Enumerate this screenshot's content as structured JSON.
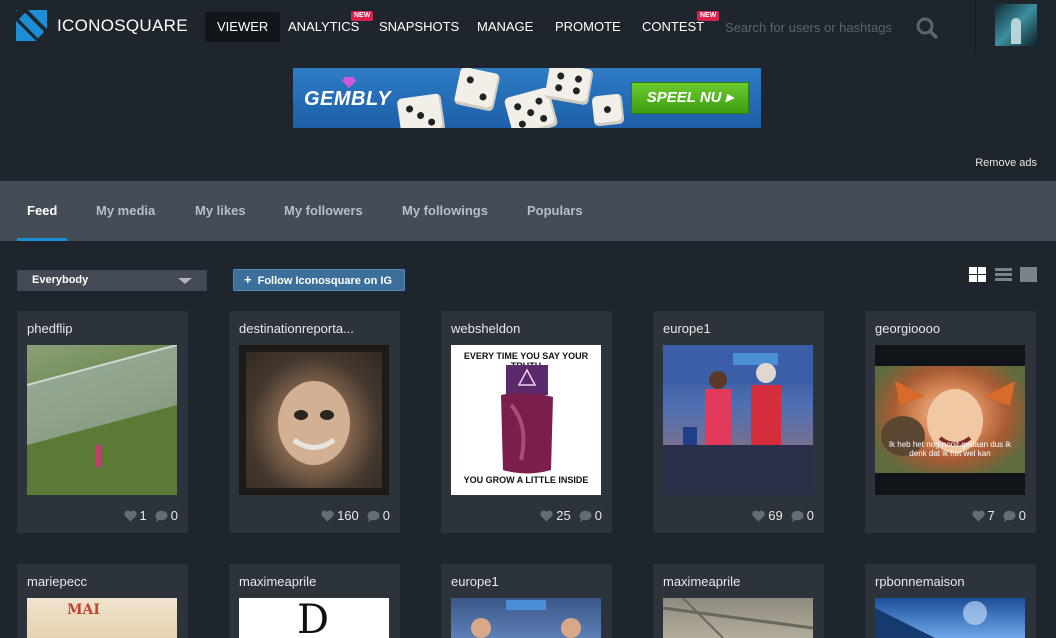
{
  "brand": {
    "name_light": "ICONO",
    "name_bold": "SQUARE",
    "accent": "#1c8ed6"
  },
  "nav": {
    "items": [
      {
        "label": "VIEWER",
        "active": true,
        "badge": ""
      },
      {
        "label": "ANALYTICS",
        "active": false,
        "badge": "NEW"
      },
      {
        "label": "SNAPSHOTS",
        "active": false,
        "badge": ""
      },
      {
        "label": "MANAGE",
        "active": false,
        "badge": ""
      },
      {
        "label": "PROMOTE",
        "active": false,
        "badge": ""
      },
      {
        "label": "CONTEST",
        "active": false,
        "badge": "NEW"
      }
    ],
    "search_placeholder": "Search for users or hashtags"
  },
  "ad": {
    "brand": "GEMBLY",
    "cta": "SPEEL NU",
    "remove_label": "Remove ads"
  },
  "tabs": [
    {
      "label": "Feed",
      "active": true
    },
    {
      "label": "My media",
      "active": false
    },
    {
      "label": "My likes",
      "active": false
    },
    {
      "label": "My followers",
      "active": false
    },
    {
      "label": "My followings",
      "active": false
    },
    {
      "label": "Populars",
      "active": false
    }
  ],
  "filter": {
    "selected": "Everybody",
    "follow_label": "Follow Iconosquare on IG"
  },
  "view_modes": [
    "grid-view-icon",
    "list-view-icon",
    "single-view-icon"
  ],
  "feed": [
    {
      "user": "phedflip",
      "likes": "1",
      "comments": "0"
    },
    {
      "user": "destinationreporta...",
      "likes": "160",
      "comments": "0"
    },
    {
      "user": "websheldon",
      "likes": "25",
      "comments": "0",
      "caption_top": "EVERY TIME YOU SAY YOUR TRUTH",
      "caption_bottom": "YOU GROW A LITTLE INSIDE"
    },
    {
      "user": "europe1",
      "likes": "69",
      "comments": "0"
    },
    {
      "user": "georgioooo",
      "likes": "7",
      "comments": "0",
      "caption": "Ik heb het nog nooit gedaan dus ik denk dat ik het wel kan"
    },
    {
      "user": "mariepecc"
    },
    {
      "user": "maximeaprile"
    },
    {
      "user": "europe1"
    },
    {
      "user": "maximeaprile"
    },
    {
      "user": "rpbonnemaison"
    }
  ]
}
